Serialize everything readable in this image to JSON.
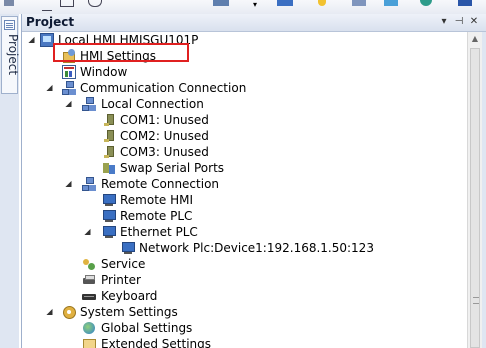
{
  "panel": {
    "title": "Project",
    "side_tab": "Project",
    "buttons": {
      "dropdown": "▾",
      "pin": "⊣",
      "close": "✕"
    }
  },
  "tree": {
    "root": "Local HMI HMISGU101P",
    "hmi_settings": "HMI Settings",
    "window": "Window",
    "communication": "Communication Connection",
    "local_connection": "Local Connection",
    "com1": "COM1: Unused",
    "com2": "COM2: Unused",
    "com3": "COM3: Unused",
    "swap": "Swap Serial Ports",
    "remote_connection": "Remote Connection",
    "remote_hmi": "Remote HMI",
    "remote_plc": "Remote PLC",
    "ethernet_plc": "Ethernet PLC",
    "network_plc": "Network Plc:Device1:192.168.1.50:123",
    "service": "Service",
    "printer": "Printer",
    "keyboard": "Keyboard",
    "system_settings": "System Settings",
    "global_settings": "Global Settings",
    "extended_settings": "Extended Settings"
  },
  "colors": {
    "highlight_border": "#e02020",
    "panel_header": "#d9e1ee"
  },
  "icons": {
    "root": "hmi-device-icon",
    "hmi_settings": "settings-icon",
    "window": "window-icon",
    "communication": "network-icon",
    "com": "serial-port-icon",
    "swap": "swap-icon",
    "remote": "monitor-icon",
    "service": "service-icon",
    "printer": "printer-icon",
    "keyboard": "keyboard-icon",
    "system": "gear-icon",
    "global": "globe-icon",
    "extended": "extended-settings-icon"
  },
  "expander": {
    "expanded": "◢"
  }
}
